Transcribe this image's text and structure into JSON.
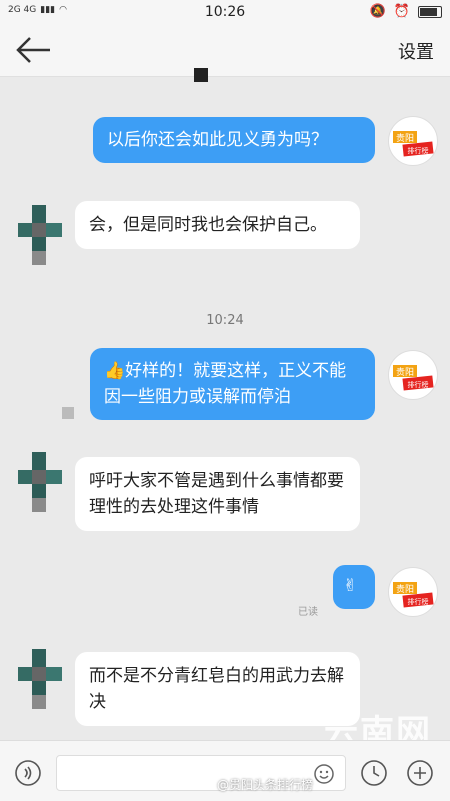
{
  "status": {
    "time": "10:26",
    "signal": "2G 4G"
  },
  "nav": {
    "settings_label": "设置"
  },
  "messages": {
    "m1": "以后你还会如此见义勇为吗？",
    "m2": "会，但是同时我也会保护自己。",
    "time_sep": "10:24",
    "m3": "👍好样的！就要这样，正义不能因一些阻力或误解而停泊",
    "m4": "呼吁大家不管是遇到什么事情都要理性的去处理这件事情",
    "m5": "✌",
    "read_label": "已读",
    "m6": "而不是不分青红皂白的用武力去解决"
  },
  "avatar_me_text": {
    "line1": "贵阳",
    "line2": "排行榜"
  },
  "watermark": "云南网",
  "weibo_handle": "@贵阳头条排行榜",
  "colors": {
    "outgoing": "#3d9ef5",
    "incoming": "#ffffff",
    "bg": "#eaeaea"
  }
}
